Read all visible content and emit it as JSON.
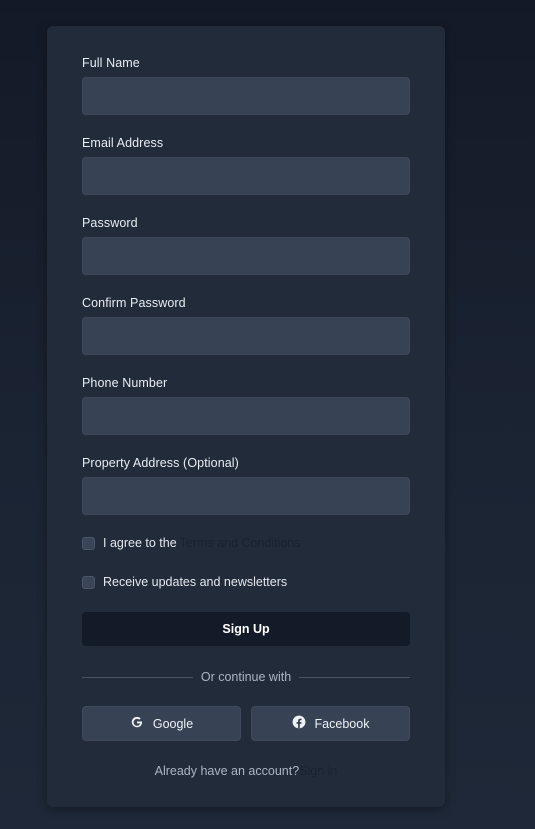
{
  "form": {
    "fields": [
      {
        "label": "Full Name",
        "value": "",
        "placeholder": ""
      },
      {
        "label": "Email Address",
        "value": "",
        "placeholder": ""
      },
      {
        "label": "Password",
        "value": "",
        "placeholder": ""
      },
      {
        "label": "Confirm Password",
        "value": "",
        "placeholder": ""
      },
      {
        "label": "Phone Number",
        "value": "",
        "placeholder": ""
      },
      {
        "label": "Property Address (Optional)",
        "value": "",
        "placeholder": ""
      }
    ],
    "terms": {
      "prefix": "I agree to the",
      "link": "Terms and Conditions",
      "checked": false
    },
    "newsletter": {
      "label": "Receive updates and newsletters",
      "checked": false
    },
    "submit_label": "Sign Up",
    "divider_text": "Or continue with",
    "social": {
      "google": {
        "label": "Google",
        "icon": "google-icon"
      },
      "facebook": {
        "label": "Facebook",
        "icon": "facebook-icon"
      }
    },
    "signin": {
      "prompt": "Already have an account?",
      "link": "Sign in"
    }
  },
  "colors": {
    "background": "#1b2433",
    "card": "#222b3a",
    "input": "#374254",
    "primary_button": "#131b28",
    "link": "#1a2232"
  }
}
